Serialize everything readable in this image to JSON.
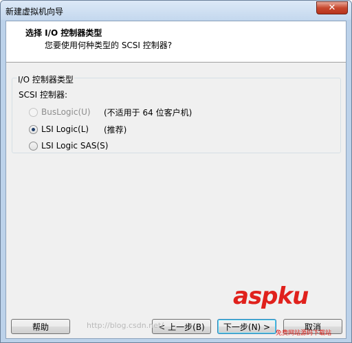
{
  "window": {
    "title": "新建虚拟机向导",
    "close_glyph": "✕"
  },
  "header": {
    "title": "选择 I/O 控制器类型",
    "subtitle": "您要使用何种类型的 SCSI 控制器?"
  },
  "group": {
    "label": "I/O 控制器类型",
    "sub_label": "SCSI 控制器:",
    "options": [
      {
        "label": "BusLogic(U)",
        "note": "(不适用于 64 位客户机)",
        "checked": false,
        "enabled": false
      },
      {
        "label": "LSI Logic(L)",
        "note": "(推荐)",
        "checked": true,
        "enabled": true
      },
      {
        "label": "LSI Logic SAS(S)",
        "note": "",
        "checked": false,
        "enabled": true
      }
    ]
  },
  "buttons": {
    "help": "帮助",
    "back": "< 上一步(B)",
    "next": "下一步(N) >",
    "cancel": "取消"
  },
  "watermark": {
    "logo": "aspku",
    "tagline": "免费网站源码下载站",
    "url": "http://blog.csdn.net/"
  },
  "colors": {
    "accent": "#3c7fb1",
    "watermark": "#e0211c"
  }
}
